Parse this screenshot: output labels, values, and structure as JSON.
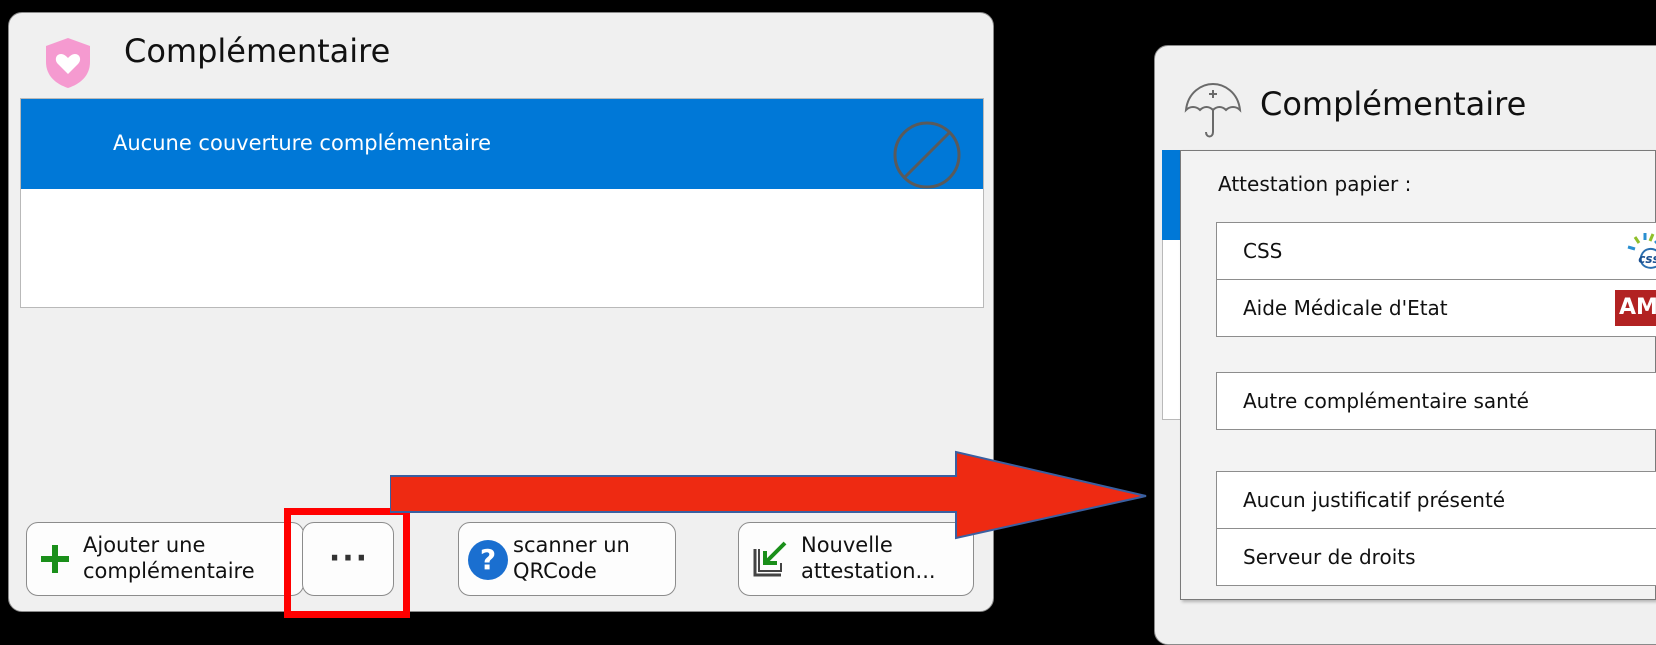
{
  "left": {
    "title": "Complémentaire",
    "selected_item": "Aucune couverture complémentaire",
    "buttons": {
      "add_line1": "Ajouter une",
      "add_line2": "complémentaire",
      "more": "···",
      "scan_line1": "scanner un",
      "scan_line2": "QRCode",
      "new_line1": "Nouvelle",
      "new_line2": "attestation..."
    }
  },
  "right": {
    "title": "Complémentaire",
    "menu": {
      "heading": "Attestation papier :",
      "items": [
        {
          "label": "CSS"
        },
        {
          "label": "Aide Médicale d'Etat",
          "badge": "AME"
        },
        {
          "label": "Autre complémentaire santé"
        },
        {
          "label": "Aucun justificatif présenté"
        },
        {
          "label": "Serveur de droits"
        }
      ]
    }
  },
  "colors": {
    "selection": "#0078d7",
    "highlight": "#ff0000",
    "add_icon": "#1a8f1a",
    "help_icon": "#1a6fd0",
    "heart_shield": "#f59ad0",
    "ame_badge": "#b22222"
  },
  "icons": [
    "heart-shield-icon",
    "no-entry-icon",
    "plus-icon",
    "help-icon",
    "import-icon",
    "umbrella-icon",
    "css-logo-icon",
    "ame-badge"
  ]
}
